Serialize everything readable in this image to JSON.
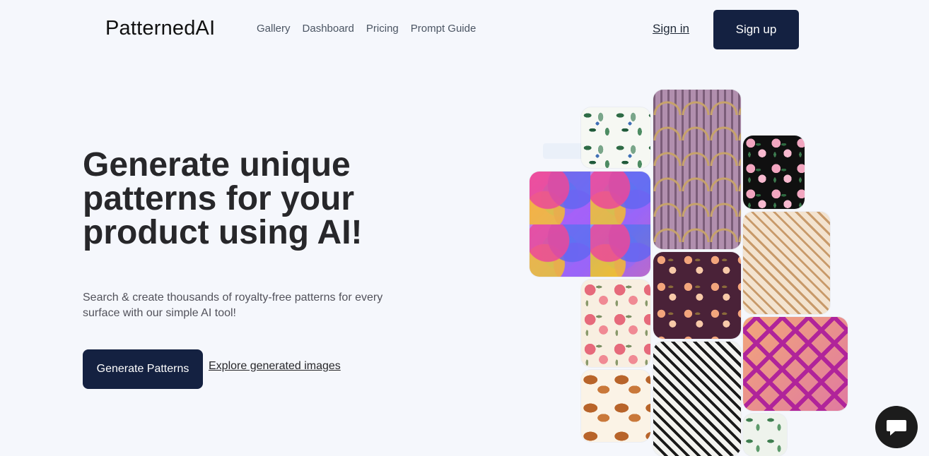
{
  "header": {
    "logo": "PatternedAI",
    "nav": [
      "Gallery",
      "Dashboard",
      "Pricing",
      "Prompt Guide"
    ],
    "sign_in": "Sign in",
    "sign_up": "Sign up"
  },
  "hero": {
    "title": "Generate unique patterns for your product using AI!",
    "subtitle": "Search & create thousands of royalty-free patterns for every surface with our simple AI tool!",
    "cta": "Generate Patterns",
    "explore": "Explore generated images"
  },
  "gallery": {
    "tiles": [
      "leaves-pattern-tile",
      "art-deco-fan-tile",
      "pink-roses-black-tile",
      "colorful-circles-tile",
      "tan-diamond-geometric-tile",
      "roses-cream-tile",
      "peach-floral-plum-tile",
      "magenta-lattice-tile",
      "pastries-pattern-tile",
      "black-white-diamond-tile",
      "green-leaves-tile"
    ]
  },
  "chat": {
    "icon": "chat-bubble-icon"
  },
  "colors": {
    "background": "#f5f7fc",
    "primary_button": "#142141",
    "chat_button": "#1c1c1c"
  }
}
